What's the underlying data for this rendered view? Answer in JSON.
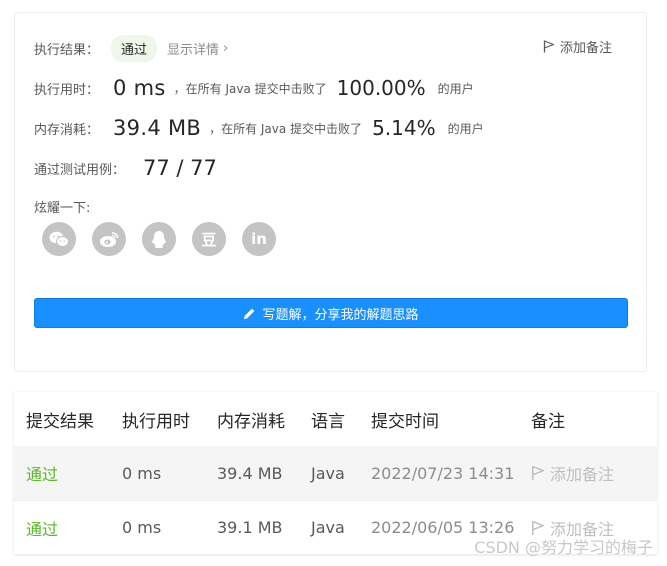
{
  "result": {
    "label": "执行结果：",
    "status": "通过",
    "detail_link": "显示详情",
    "chevron": "›",
    "add_note": "添加备注"
  },
  "runtime": {
    "label": "执行用时：",
    "value": "0 ms",
    "middle": "，在所有 Java 提交中击败了",
    "percent": "100.00%",
    "suffix": "的用户"
  },
  "memory": {
    "label": "内存消耗：",
    "value": "39.4 MB",
    "middle": "，在所有 Java 提交中击败了",
    "percent": "5.14%",
    "suffix": "的用户"
  },
  "testcases": {
    "label": "通过测试用例：",
    "value": "77 / 77"
  },
  "share": {
    "label": "炫耀一下:",
    "icons": [
      "wechat-icon",
      "weibo-icon",
      "qq-icon",
      "douban-icon",
      "linkedin-icon"
    ],
    "douban_glyph": "豆",
    "linkedin_glyph": "in"
  },
  "write_solution_button": "写题解，分享我的解题思路",
  "table": {
    "headers": [
      "提交结果",
      "执行用时",
      "内存消耗",
      "语言",
      "提交时间",
      "备注"
    ],
    "rows": [
      {
        "status": "通过",
        "runtime": "0 ms",
        "memory": "39.4 MB",
        "language": "Java",
        "time": "2022/07/23 14:31",
        "note": "添加备注"
      },
      {
        "status": "通过",
        "runtime": "0 ms",
        "memory": "39.1 MB",
        "language": "Java",
        "time": "2022/06/05 13:26",
        "note": "添加备注"
      }
    ]
  },
  "watermark": "CSDN @努力学习的梅子",
  "colors": {
    "accent": "#1890ff",
    "success": "#5ab726",
    "tag_bg": "#eef7ea",
    "share_icon_bg": "#c4c4c4"
  }
}
